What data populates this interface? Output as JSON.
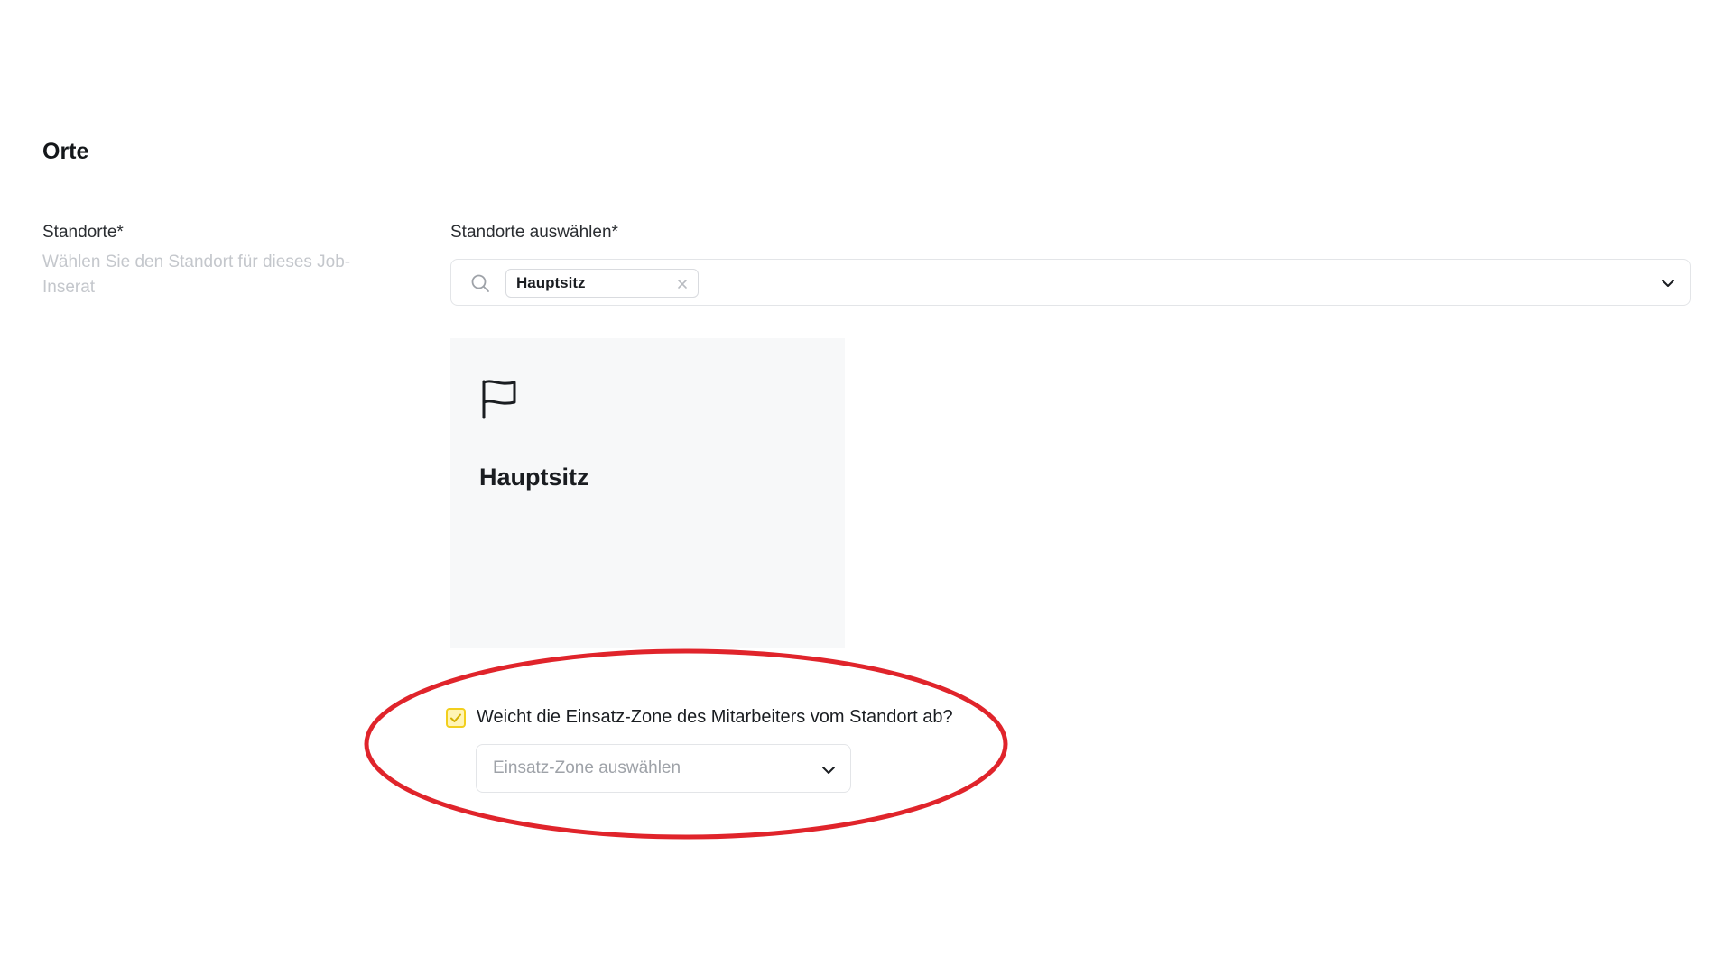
{
  "section": {
    "title": "Orte"
  },
  "locations_field": {
    "label": "Standorte*",
    "description": "Wählen Sie den Standort für dieses Job-Inserat"
  },
  "locations_select": {
    "label": "Standorte auswählen*",
    "selected_chips": [
      "Hauptsitz"
    ],
    "icon_search": "search-icon",
    "icon_dropdown": "chevron-down-icon",
    "icon_remove": "close-icon"
  },
  "location_card": {
    "icon": "flag-icon",
    "title": "Hauptsitz"
  },
  "zone_option": {
    "checkbox_checked": true,
    "checkbox_label": "Weicht die Einsatz-Zone des Mitarbeiters vom Standort ab?",
    "select_placeholder": "Einsatz-Zone auswählen"
  },
  "colors": {
    "checkbox_border": "#f2cf1d",
    "checkbox_fill": "#fff4b5",
    "annotation": "#e0242b",
    "card_background": "#f7f8f9"
  }
}
